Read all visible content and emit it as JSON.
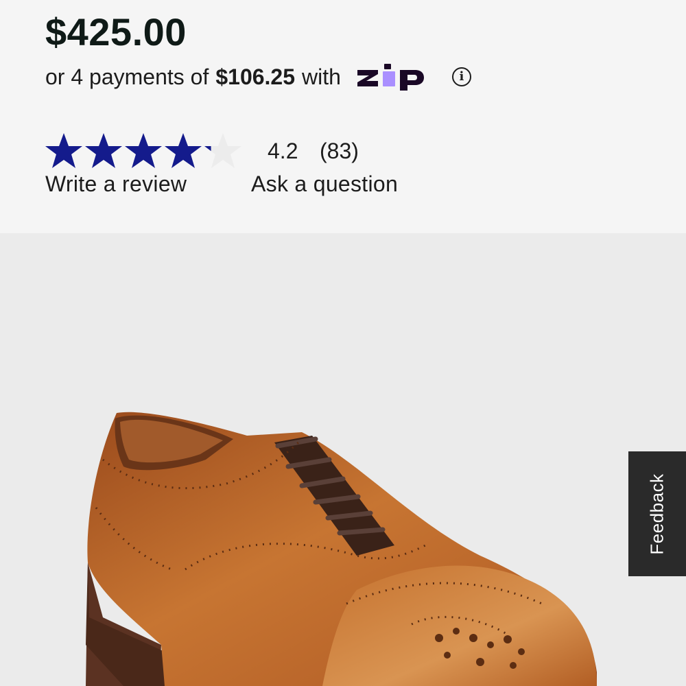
{
  "product": {
    "price": "$425.00",
    "installments": {
      "prefix": "or 4 payments of",
      "amount": "$106.25",
      "suffix": "with",
      "provider_logo": "Zip",
      "info_icon": "info-circle-icon"
    },
    "rating": {
      "value": "4.2",
      "count": "(83)",
      "stars_filled": 4.2,
      "stars_total": 5,
      "star_color": "#141b8c",
      "empty_star_color": "#ececec"
    },
    "links": {
      "write_review": "Write a review",
      "ask_question": "Ask a question"
    },
    "image": {
      "alt": "brown leather cap-toe oxford shoe",
      "primary_color": "#b8652a"
    }
  },
  "feedback": {
    "label": "Feedback"
  },
  "colors": {
    "info_background": "#f5f5f5",
    "image_background": "#ebebeb",
    "zip_dark": "#1a0826",
    "zip_purple": "#aa8fff",
    "feedback_background": "#2a2a2a"
  }
}
